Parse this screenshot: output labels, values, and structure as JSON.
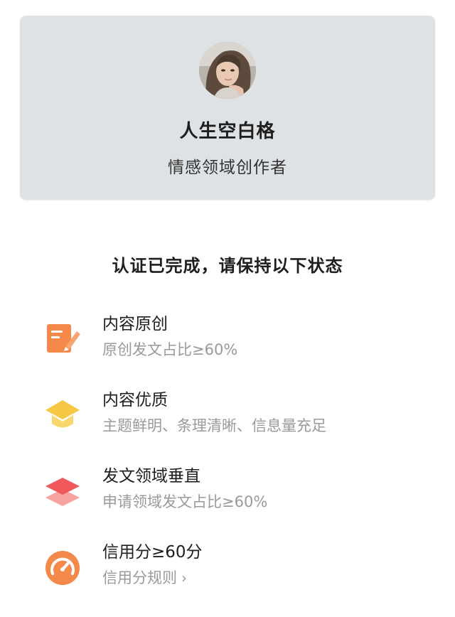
{
  "profile": {
    "name": "人生空白格",
    "role": "情感领域创作者"
  },
  "section": {
    "title": "认证已完成，请保持以下状态"
  },
  "requirements": [
    {
      "icon": "edit-document-icon",
      "icon_color": "#f5894a",
      "title": "内容原创",
      "description": "原创发文占比≥60%"
    },
    {
      "icon": "graduation-cap-icon",
      "icon_color": "#f7c844",
      "title": "内容优质",
      "description": "主题鲜明、条理清晰、信息量充足"
    },
    {
      "icon": "layers-icon",
      "icon_color": "#f2595d",
      "title": "发文领域垂直",
      "description": "申请领域发文占比≥60%"
    },
    {
      "icon": "gauge-icon",
      "icon_color": "#f5894a",
      "title": "信用分≥60分",
      "description": "信用分规则",
      "chevron": "›"
    }
  ],
  "colors": {
    "card_background": "#dfe2e5",
    "primary_text": "#1e1e1e",
    "secondary_text": "#9a9a9a"
  }
}
